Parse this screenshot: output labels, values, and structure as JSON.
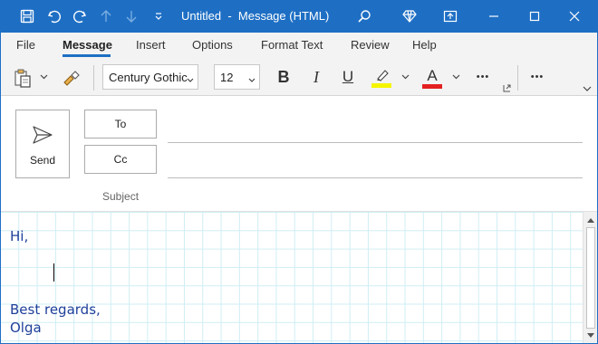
{
  "titlebar": {
    "doc_title": "Untitled",
    "separator": "-",
    "app_title": "Message (HTML)",
    "icons": [
      "save-icon",
      "undo-icon",
      "redo-icon",
      "up-arrow-icon",
      "down-arrow-icon",
      "customize-icon",
      "search-icon",
      "diamond-icon",
      "restore-window-icon",
      "minimize-icon",
      "maximize-icon",
      "close-icon"
    ],
    "accent_color": "#1e6fc4"
  },
  "tabs": [
    {
      "label": "File"
    },
    {
      "label": "Message",
      "active": true
    },
    {
      "label": "Insert"
    },
    {
      "label": "Options"
    },
    {
      "label": "Format Text"
    },
    {
      "label": "Review"
    },
    {
      "label": "Help"
    }
  ],
  "ribbon": {
    "font_name": "Century Gothic",
    "font_size": "12",
    "bold": "B",
    "italic": "I",
    "underline": "U",
    "font_color_glyph": "A",
    "highlight_color": "#f5f500",
    "font_color": "#e32020",
    "more": "•••"
  },
  "header": {
    "send_label": "Send",
    "to_label": "To",
    "cc_label": "Cc",
    "subject_label": "Subject",
    "to_value": "",
    "cc_value": ""
  },
  "body": {
    "line1": "Hi,",
    "line2": "Best regards,",
    "line3": "Olga",
    "text_color": "#1f3f9a",
    "grid_color": "#cfeef4"
  }
}
